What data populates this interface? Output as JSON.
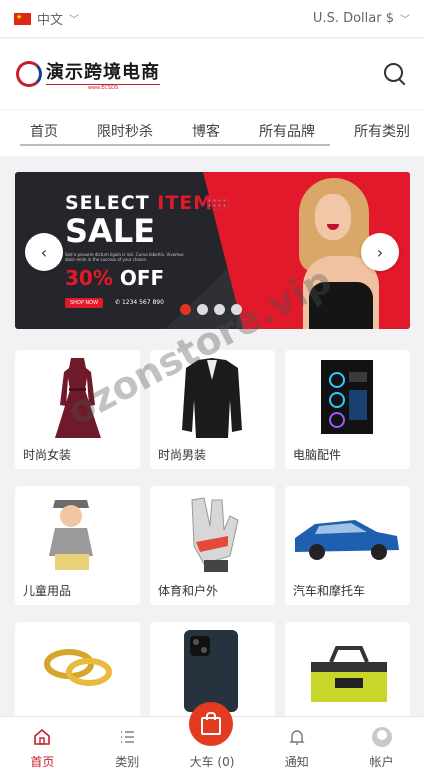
{
  "topbar": {
    "language": "中文",
    "currency": "U.S. Dollar $"
  },
  "header": {
    "logo_title": "演示跨境电商",
    "logo_sub": "www.ECSDS"
  },
  "nav": {
    "items": [
      "首页",
      "限时秒杀",
      "博客",
      "所有品牌",
      "所有类别"
    ]
  },
  "banner": {
    "select": "SELECT ",
    "item": "ITEM",
    "sale": "SALE",
    "small_text": "Sed a posuere dictum ligula is nisi. Curvo lobortis. Vivamus dolor enim in the success of your choice.",
    "off_num": "30%",
    "off_text": " OFF",
    "shop_now": "SHOP NOW",
    "phone": "1234 567 890",
    "prev_icon": "‹",
    "next_icon": "›",
    "slide_count": 4,
    "active_slide": 1
  },
  "categories": [
    {
      "name": "时尚女装",
      "icon": "dress-image"
    },
    {
      "name": "时尚男装",
      "icon": "blazer-image"
    },
    {
      "name": "电脑配件",
      "icon": "pc-case-image"
    },
    {
      "name": "儿童用品",
      "icon": "kid-image"
    },
    {
      "name": "体育和户外",
      "icon": "gloves-image"
    },
    {
      "name": "汽车和摩托车",
      "icon": "car-image"
    },
    {
      "name": "",
      "icon": "rings-image"
    },
    {
      "name": "",
      "icon": "phone-image"
    },
    {
      "name": "",
      "icon": "toolbag-image"
    }
  ],
  "watermark": "ozonstore.vip",
  "bottom_nav": {
    "home": "首页",
    "categories": "类别",
    "cart": "大车 (0)",
    "notifications": "通知",
    "account": "帐户"
  },
  "colors": {
    "accent": "#e1192a",
    "brand": "#c81d2a",
    "banner_dark": "#24262b"
  }
}
